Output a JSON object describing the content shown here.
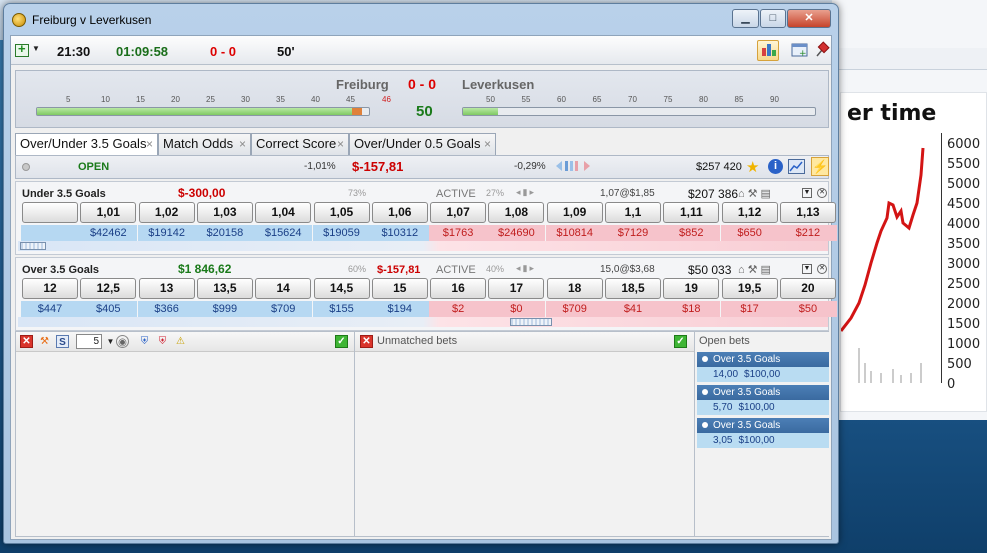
{
  "window": {
    "title": "Freiburg v Leverkusen"
  },
  "toolbar": {
    "time": "21:30",
    "clock": "01:09:58",
    "score": "0 - 0",
    "minute": "50'"
  },
  "scoreboard": {
    "home": "Freiburg",
    "score": "0 - 0",
    "away": "Leverkusen",
    "minute": "50",
    "first_half_labels": [
      "5",
      "10",
      "15",
      "20",
      "25",
      "30",
      "35",
      "40",
      "45",
      "46"
    ],
    "second_half_labels": [
      "50",
      "55",
      "60",
      "65",
      "70",
      "75",
      "80",
      "85",
      "90"
    ]
  },
  "tabs": [
    {
      "label": "Over/Under 3.5 Goals",
      "active": true
    },
    {
      "label": "Match Odds"
    },
    {
      "label": "Correct Score"
    },
    {
      "label": "Over/Under 0.5 Goals"
    }
  ],
  "market": {
    "status": "OPEN",
    "back_pct": "-1,01%",
    "pl": "$-157,81",
    "lay_pct": "-0,29%",
    "matched": "$257 420"
  },
  "runners": [
    {
      "name": "Under 3.5 Goals",
      "pl": "$-300,00",
      "pl_color": "#cc0000",
      "pct": "73%",
      "pl2": "",
      "status": "ACTIVE",
      "pct2": "27%",
      "avg": "1,07@$1,85",
      "amount": "$207 386",
      "odds": [
        "",
        "1,01",
        "1,02",
        "1,03",
        "1,04",
        "1,05",
        "1,06",
        "1,07",
        "1,08",
        "1,09",
        "1,1",
        "1,11",
        "1,12",
        "1,13"
      ],
      "volumes": [
        "",
        "$42462",
        "$19142",
        "$20158",
        "$15624",
        "$19059",
        "$10312",
        "$1763",
        "$24690",
        "$10814",
        "$7129",
        "$852",
        "$650",
        "$212"
      ]
    },
    {
      "name": "Over 3.5 Goals",
      "pl": "$1 846,62",
      "pl_color": "#1a7a1a",
      "pct": "60%",
      "pl2": "$-157,81",
      "status": "ACTIVE",
      "pct2": "40%",
      "avg": "15,0@$3,68",
      "amount": "$50 033",
      "odds": [
        "12",
        "12,5",
        "13",
        "13,5",
        "14",
        "14,5",
        "15",
        "16",
        "17",
        "18",
        "18,5",
        "19",
        "19,5",
        "20"
      ],
      "volumes": [
        "$447",
        "$405",
        "$366",
        "$999",
        "$709",
        "$155",
        "$194",
        "$2",
        "$0",
        "$709",
        "$41",
        "$18",
        "$17",
        "$50"
      ]
    }
  ],
  "bottom": {
    "stake_value": "5",
    "unmatched_title": "Unmatched bets",
    "open_title": "Open bets",
    "open_bets": [
      {
        "name": "Over 3.5 Goals",
        "odds": "14,00",
        "stake": "$100,00"
      },
      {
        "name": "Over 3.5 Goals",
        "odds": "5,70",
        "stake": "$100,00"
      },
      {
        "name": "Over 3.5 Goals",
        "odds": "3,05",
        "stake": "$100,00"
      }
    ]
  },
  "background": {
    "chart_title": "er time",
    "y_ticks": [
      "6000",
      "5500",
      "5000",
      "4500",
      "4000",
      "3500",
      "3000",
      "2500",
      "2000",
      "1500",
      "1000",
      "500",
      "0"
    ]
  }
}
